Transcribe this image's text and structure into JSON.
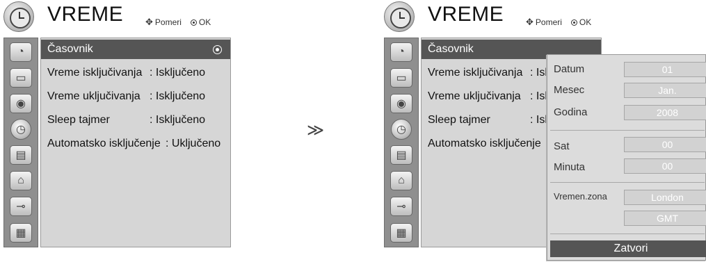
{
  "colors": {
    "selected_bg": "#555555",
    "menu_bg": "#d6d6d6",
    "sidebar_bg": "#8f8f8f"
  },
  "menu": {
    "title": "VREME",
    "hint_move": "Pomeri",
    "hint_ok": "OK",
    "sidebar_icons": [
      "satellite-dish-icon",
      "tv-screen-icon",
      "speaker-icon",
      "clock-icon",
      "calendar-icon",
      "lock-icon",
      "input-plug-icon",
      "photo-icon"
    ],
    "rows": [
      {
        "label": "Časovnik",
        "value": "",
        "selected": true
      },
      {
        "label": "Vreme isključivanja",
        "value": ": Isključeno"
      },
      {
        "label": "Vreme uključivanja",
        "value": ": Isključeno"
      },
      {
        "label": "Sleep tajmer",
        "value": ": Isključeno"
      },
      {
        "label": "Automatsko isključenje",
        "value": ": Uključeno"
      }
    ],
    "right_values_truncated": [
      ": Isk",
      ": Isk",
      ": Isk",
      ":"
    ]
  },
  "arrow": "≫",
  "popup": {
    "datum_label": "Datum",
    "datum_value": "01",
    "mesec_label": "Mesec",
    "mesec_value": "Jan.",
    "godina_label": "Godina",
    "godina_value": "2008",
    "sat_label": "Sat",
    "sat_value": "00",
    "minuta_label": "Minuta",
    "minuta_value": "00",
    "zona_label": "Vremen.zona",
    "zona_value": "London",
    "gmt_value": "GMT",
    "close_label": "Zatvori"
  }
}
